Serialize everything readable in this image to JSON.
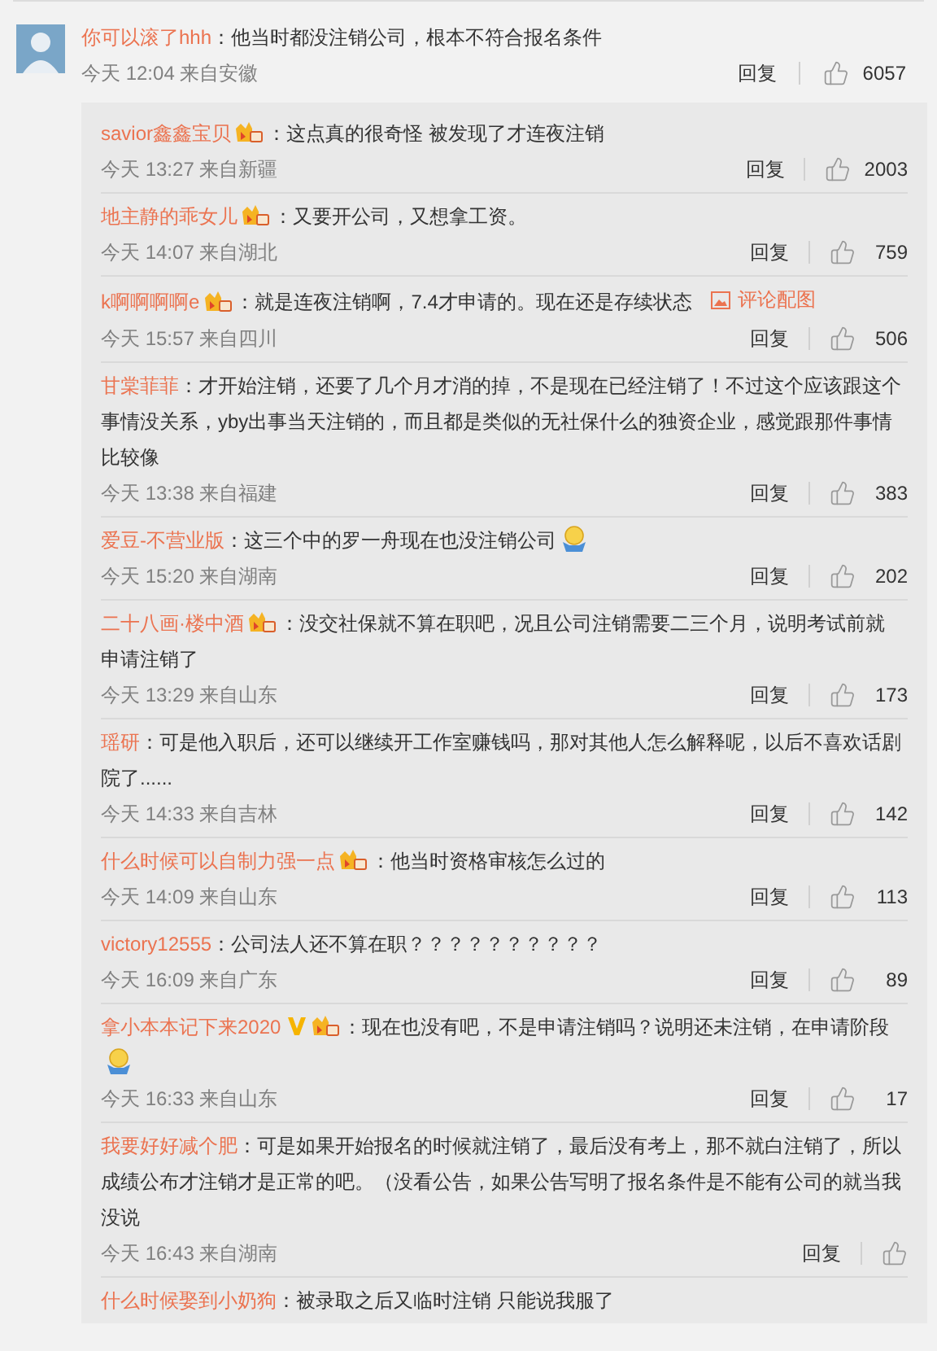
{
  "comment": {
    "user": "你可以滚了hhh",
    "text": "：他当时都没注销公司，根本不符合报名条件",
    "meta": "今天 12:04 来自安徽",
    "reply": "回复",
    "likes": "6057"
  },
  "replies": [
    {
      "user": "savior鑫鑫宝贝",
      "verified": false,
      "member": true,
      "text": "：这点真的很奇怪 被发现了才连夜注销",
      "emoji": false,
      "meta": "今天 13:27 来自新疆",
      "reply": "回复",
      "likes": "2003"
    },
    {
      "user": "地主静的乖女儿",
      "verified": false,
      "member": true,
      "text": "：又要开公司，又想拿工资。",
      "emoji": false,
      "meta": "今天 14:07 来自湖北",
      "reply": "回复",
      "likes": "759"
    },
    {
      "user": "k啊啊啊啊e",
      "verified": false,
      "member": true,
      "text": "：就是连夜注销啊，7.4才申请的。现在还是存续状态",
      "emoji": false,
      "image_link": "评论配图",
      "meta": "今天 15:57 来自四川",
      "reply": "回复",
      "likes": "506"
    },
    {
      "user": "甘棠菲菲",
      "verified": false,
      "member": false,
      "text": "：才开始注销，还要了几个月才消的掉，不是现在已经注销了！不过这个应该跟这个事情没关系，yby出事当天注销的，而且都是类似的无社保什么的独资企业，感觉跟那件事情比较像",
      "emoji": false,
      "meta": "今天 13:38 来自福建",
      "reply": "回复",
      "likes": "383"
    },
    {
      "user": "爱豆-不营业版",
      "verified": false,
      "member": false,
      "text": "：这三个中的罗一舟现在也没注销公司",
      "emoji": true,
      "meta": "今天 15:20 来自湖南",
      "reply": "回复",
      "likes": "202"
    },
    {
      "user": "二十八画·楼中酒",
      "verified": false,
      "member": true,
      "text": "：没交社保就不算在职吧，况且公司注销需要二三个月，说明考试前就申请注销了",
      "emoji": false,
      "meta": "今天 13:29 来自山东",
      "reply": "回复",
      "likes": "173"
    },
    {
      "user": "瑶研",
      "verified": false,
      "member": false,
      "text": "：可是他入职后，还可以继续开工作室赚钱吗，那对其他人怎么解释呢，以后不喜欢话剧院了......",
      "emoji": false,
      "meta": "今天 14:33 来自吉林",
      "reply": "回复",
      "likes": "142"
    },
    {
      "user": "什么时候可以自制力强一点",
      "verified": false,
      "member": true,
      "text": "：他当时资格审核怎么过的",
      "emoji": false,
      "meta": "今天 14:09 来自山东",
      "reply": "回复",
      "likes": "113"
    },
    {
      "user": "victory12555",
      "verified": false,
      "member": false,
      "text": "：公司法人还不算在职？？？？？？？？？？",
      "emoji": false,
      "meta": "今天 16:09 来自广东",
      "reply": "回复",
      "likes": "89"
    },
    {
      "user": "拿小本本记下来2020",
      "verified": true,
      "member": true,
      "text": "：现在也没有吧，不是申请注销吗？说明还未注销，在申请阶段",
      "emoji": true,
      "meta": "今天 16:33 来自山东",
      "reply": "回复",
      "likes": "17"
    },
    {
      "user": "我要好好减个肥",
      "verified": false,
      "member": false,
      "text": "：可是如果开始报名的时候就注销了，最后没有考上，那不就白注销了，所以成绩公布才注销才是正常的吧。（没看公告，如果公告写明了报名条件是不能有公司的就当我没说",
      "emoji": false,
      "meta": "今天 16:43 来自湖南",
      "reply": "回复"
    },
    {
      "user": "什么时候娶到小奶狗",
      "verified": false,
      "member": false,
      "text": "：被录取之后又临时注销 只能说我服了",
      "emoji": false
    }
  ]
}
